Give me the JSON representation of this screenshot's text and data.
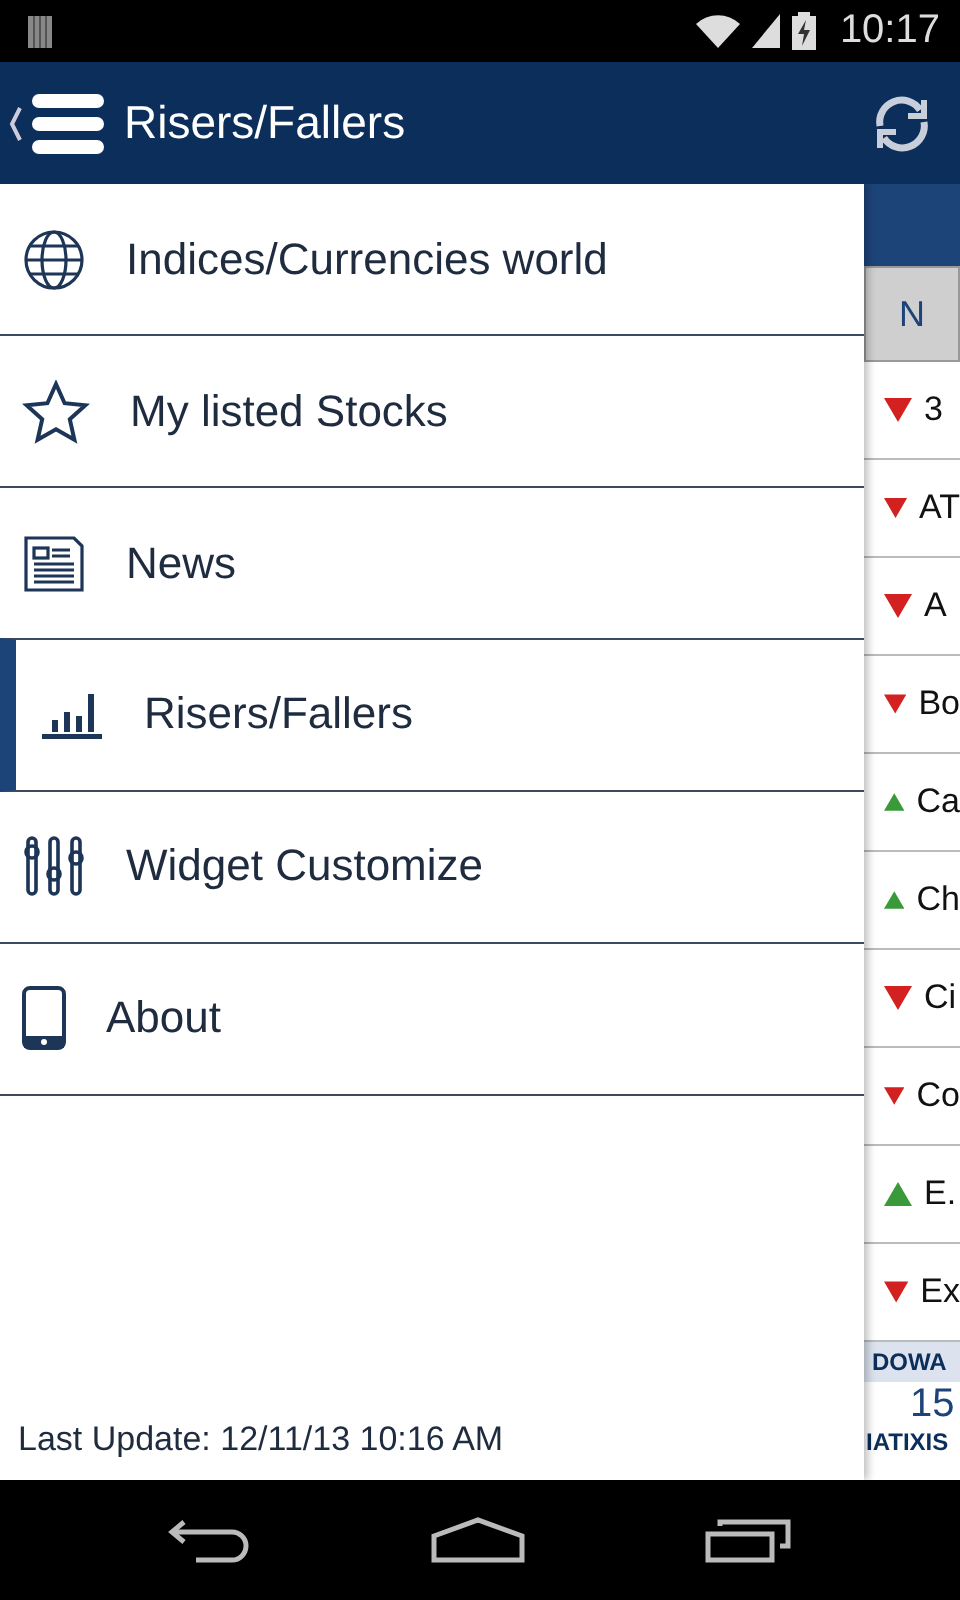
{
  "status_bar": {
    "time": "10:17"
  },
  "app_bar": {
    "title": "Risers/Fallers"
  },
  "drawer": {
    "items": [
      {
        "label": "Indices/Currencies world",
        "selected": false
      },
      {
        "label": "My listed Stocks",
        "selected": false
      },
      {
        "label": "News",
        "selected": false
      },
      {
        "label": "Risers/Fallers",
        "selected": true
      },
      {
        "label": "Widget Customize",
        "selected": false
      },
      {
        "label": "About",
        "selected": false
      }
    ],
    "last_update": "Last Update: 12/11/13 10:16 AM"
  },
  "behind": {
    "column_1": "N",
    "rows": [
      {
        "name": "3",
        "kind": "down"
      },
      {
        "name": "AT",
        "kind": "down"
      },
      {
        "name": "A",
        "kind": "down"
      },
      {
        "name": "Bo",
        "kind": "down"
      },
      {
        "name": "Ca",
        "kind": "up"
      },
      {
        "name": "Ch",
        "kind": "up"
      },
      {
        "name": "Ci",
        "kind": "down"
      },
      {
        "name": "Co",
        "kind": "down"
      },
      {
        "name": "E.",
        "kind": "up"
      },
      {
        "name": "Ex",
        "kind": "down"
      }
    ],
    "ticker_title": "DOWA",
    "ticker_value": "15",
    "ticker_source": "IATIXIS"
  }
}
